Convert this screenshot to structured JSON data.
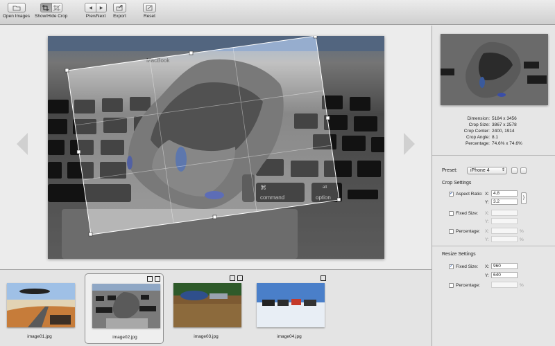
{
  "toolbar": {
    "open_images": "Open Images",
    "show_hide_crop": "Show/Hide Crop",
    "prev_next": "Prev/Next",
    "export": "Export",
    "reset": "Reset"
  },
  "info": {
    "dimension_label": "Dimension:",
    "dimension": "5184 x 3456",
    "crop_size_label": "Crop Size:",
    "crop_size": "3867 x 2578",
    "crop_center_label": "Crop Center:",
    "crop_center": "2400, 1914",
    "crop_angle_label": "Crop Angle:",
    "crop_angle": "8.1",
    "percentage_label": "Percentage:",
    "percentage": "74.6% x 74.6%"
  },
  "preset": {
    "label": "Preset:",
    "value": "iPhone 4"
  },
  "crop_settings": {
    "title": "Crop Settings",
    "aspect_ratio_label": "Aspect Ratio:",
    "aspect_x": "4.8",
    "aspect_y": "3.2",
    "aspect_checked": true,
    "fixed_size_label": "Fixed Size:",
    "fixed_checked": false,
    "percentage_label": "Percentage:",
    "percentage_checked": false,
    "x_label": "X:",
    "y_label": "Y:",
    "pct": "%"
  },
  "resize_settings": {
    "title": "Resize Settings",
    "fixed_size_label": "Fixed Size:",
    "fixed_x": "960",
    "fixed_y": "640",
    "fixed_checked": true,
    "percentage_label": "Percentage:",
    "percentage_checked": false
  },
  "filmstrip": [
    {
      "name": "image01.jpg",
      "selected": false
    },
    {
      "name": "image02.jpg",
      "selected": true
    },
    {
      "name": "image03.jpg",
      "selected": false
    },
    {
      "name": "image04.jpg",
      "selected": false
    }
  ],
  "photo": {
    "keycap_command": "command",
    "keycap_alt": "alt",
    "keycap_option": "option",
    "keycap_cmd_symbol": "⌘"
  }
}
